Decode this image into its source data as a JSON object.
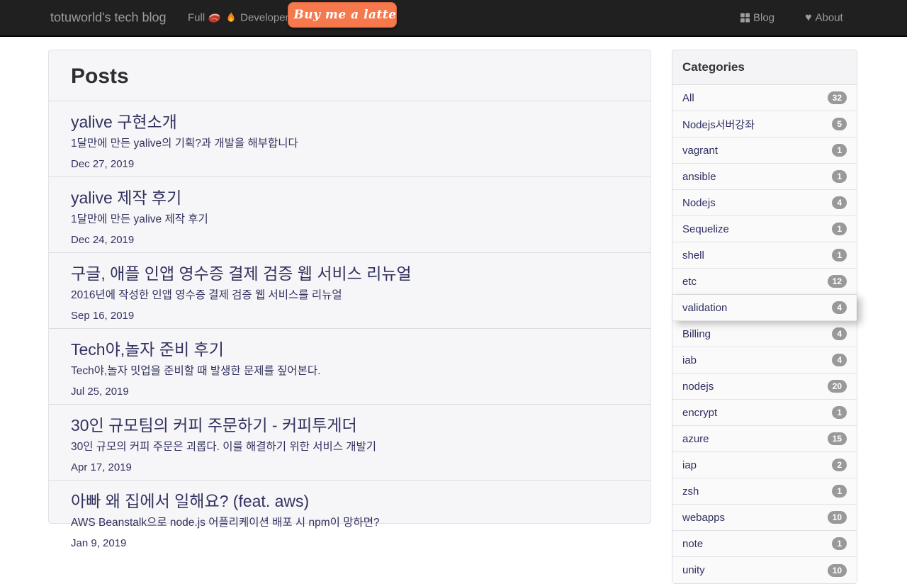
{
  "navbar": {
    "brand": "totuworld's tech blog",
    "tagline_prefix": "Full",
    "tagline_suffix": "Developer",
    "tagline_icons": [
      "steak-icon",
      "fire-icon"
    ],
    "bmc_label": "Buy me a latte",
    "links": [
      {
        "label": "Blog",
        "icon": "grid-icon"
      },
      {
        "label": "About",
        "icon": "heart-icon"
      }
    ]
  },
  "posts": {
    "heading": "Posts",
    "items": [
      {
        "title": "yalive 구현소개",
        "description": "1달만에 만든 yalive의 기획?과 개발을 해부합니다",
        "date": "Dec 27, 2019"
      },
      {
        "title": "yalive 제작 후기",
        "description": "1달만에 만든 yalive 제작 후기",
        "date": "Dec 24, 2019"
      },
      {
        "title": "구글, 애플 인앱 영수증 결제 검증 웹 서비스 리뉴얼",
        "description": "2016년에 작성한 인앱 영수증 결제 검증 웹 서비스를 리뉴얼",
        "date": "Sep 16, 2019"
      },
      {
        "title": "Tech야,놀자 준비 후기",
        "description": "Tech야,놀자 밋업을 준비할 때 발생한 문제를 짚어본다.",
        "date": "Jul 25, 2019"
      },
      {
        "title": "30인 규모팀의 커피 주문하기 - 커피투게더",
        "description": "30인 규모의 커피 주문은 괴롭다. 이를 해결하기 위한 서비스 개발기",
        "date": "Apr 17, 2019"
      },
      {
        "title": "아빠 왜 집에서 일해요? (feat. aws)",
        "description": "AWS Beanstalk으로 node.js 어플리케이션 배포 시 npm이 망하면?",
        "date": "Jan 9, 2019"
      }
    ]
  },
  "categories": {
    "heading": "Categories",
    "items": [
      {
        "label": "All",
        "count": "32"
      },
      {
        "label": "Nodejs서버강좌",
        "count": "5"
      },
      {
        "label": "vagrant",
        "count": "1"
      },
      {
        "label": "ansible",
        "count": "1"
      },
      {
        "label": "Nodejs",
        "count": "4"
      },
      {
        "label": "Sequelize",
        "count": "1"
      },
      {
        "label": "shell",
        "count": "1"
      },
      {
        "label": "etc",
        "count": "12"
      },
      {
        "label": "validation",
        "count": "4",
        "elevated": true
      },
      {
        "label": "Billing",
        "count": "4"
      },
      {
        "label": "iab",
        "count": "4"
      },
      {
        "label": "nodejs",
        "count": "20"
      },
      {
        "label": "encrypt",
        "count": "1"
      },
      {
        "label": "azure",
        "count": "15"
      },
      {
        "label": "iap",
        "count": "2"
      },
      {
        "label": "zsh",
        "count": "1"
      },
      {
        "label": "webapps",
        "count": "10"
      },
      {
        "label": "note",
        "count": "1"
      },
      {
        "label": "unity",
        "count": "10"
      }
    ]
  },
  "colors": {
    "navbar_bg": "#202020",
    "navbar_text": "#9d9d9d",
    "accent_orange": "#f5794d",
    "link_navy": "#32315f",
    "badge_gray": "#999999"
  }
}
